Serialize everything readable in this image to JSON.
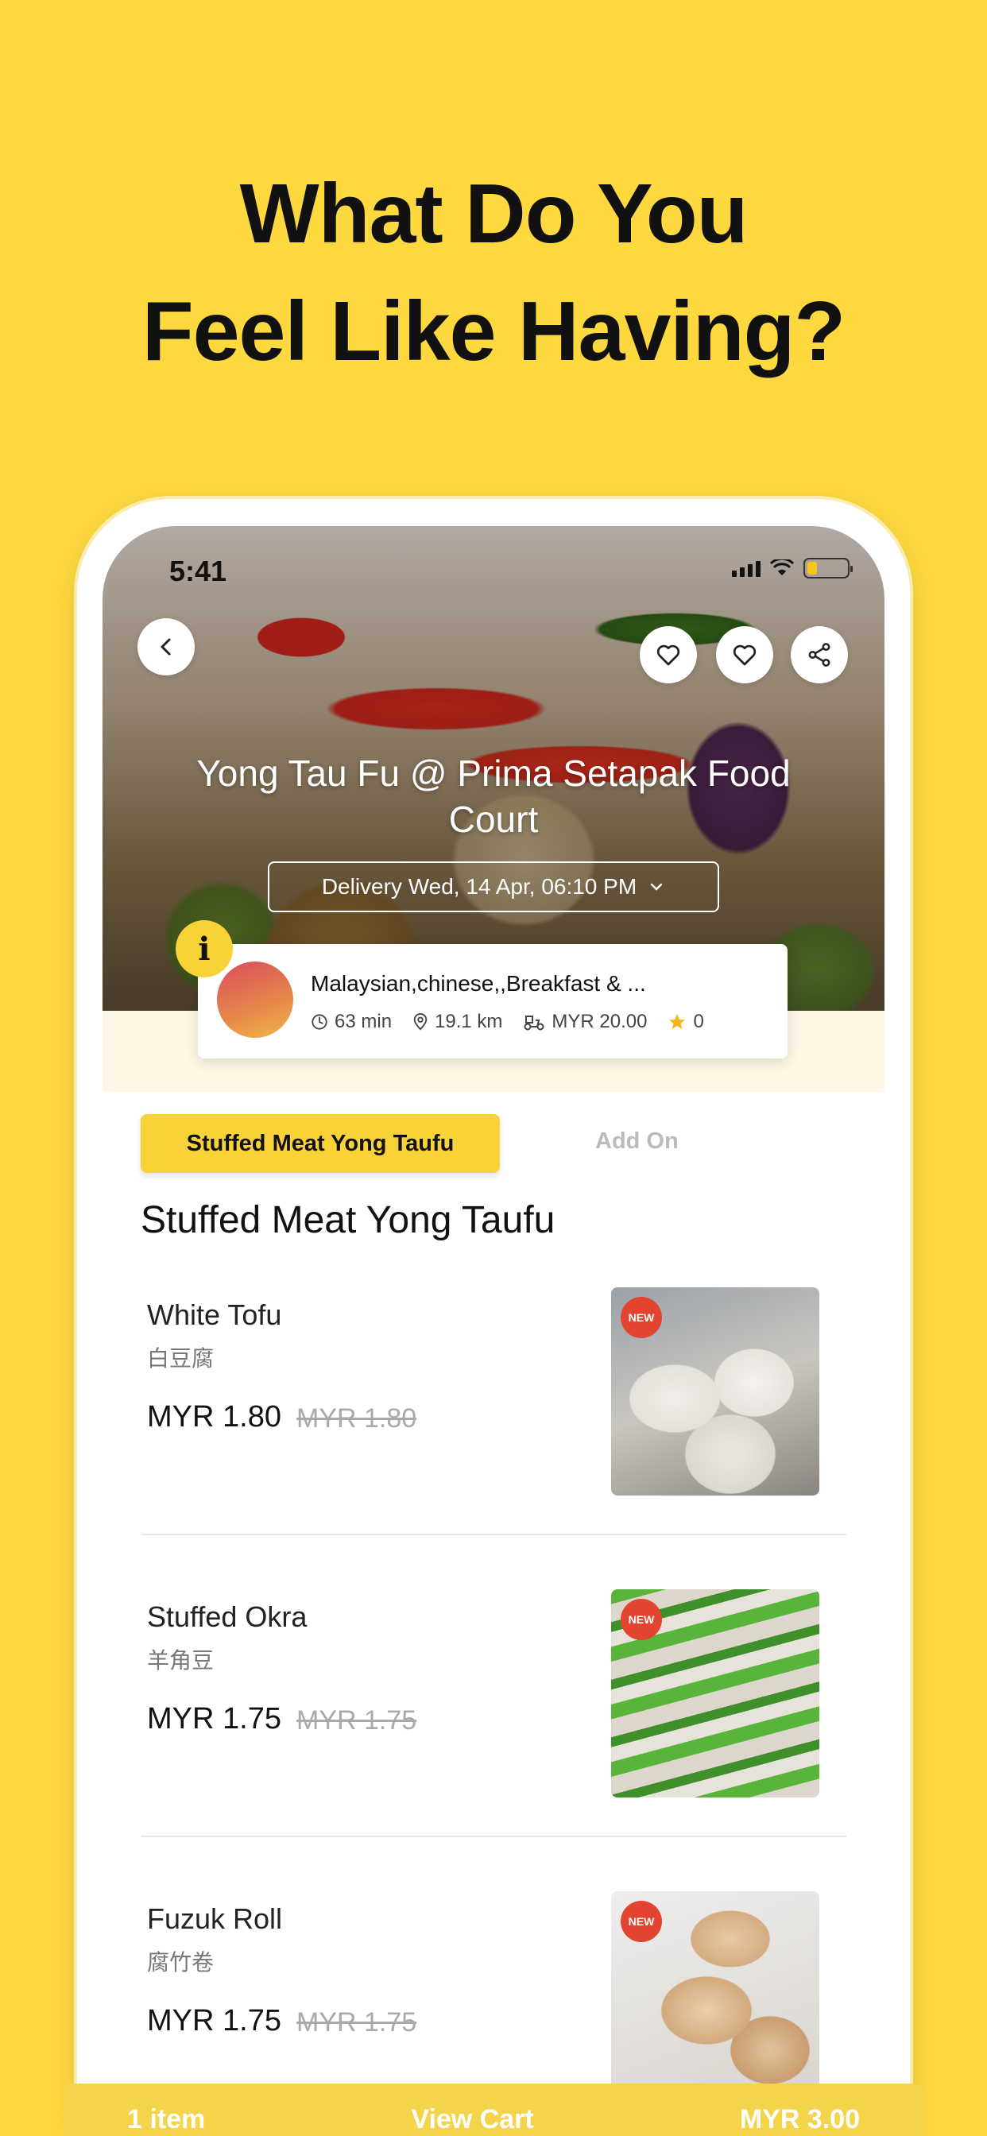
{
  "headline": {
    "line1": "What Do You",
    "line2": "Feel Like Having?"
  },
  "status_bar": {
    "time": "5:41",
    "signal_icon": "cellular-signal-icon",
    "wifi_icon": "wifi-icon",
    "battery_icon": "battery-icon"
  },
  "restaurant": {
    "name": "Yong Tau Fu @ Prima Setapak Food Court",
    "delivery": "Delivery Wed, 14 Apr, 06:10 PM",
    "cuisine": "Malaysian,chinese,,Breakfast & ...",
    "time": "63 min",
    "distance": "19.1 km",
    "delivery_fee": "MYR 20.00",
    "rating": "0",
    "info_badge": "i"
  },
  "tabs": [
    {
      "label": "Stuffed Meat Yong Taufu",
      "active": true
    },
    {
      "label": "Add On",
      "active": false
    }
  ],
  "section_title": "Stuffed Meat Yong Taufu",
  "items": [
    {
      "name": "White Tofu",
      "chinese": "白豆腐",
      "price": "MYR 1.80",
      "old_price": "MYR 1.80",
      "badge": "NEW"
    },
    {
      "name": "Stuffed Okra",
      "chinese": "羊角豆",
      "price": "MYR 1.75",
      "old_price": "MYR 1.75",
      "badge": "NEW"
    },
    {
      "name": "Fuzuk Roll",
      "chinese": "腐竹卷",
      "price": "MYR 1.75",
      "old_price": "MYR 1.75",
      "badge": "NEW"
    }
  ],
  "cart": {
    "count": "1 item",
    "label": "View Cart",
    "total": "MYR 3.00"
  },
  "colors": {
    "background": "#FDD83F",
    "accent": "#F7D338",
    "new_badge": "#e2442f"
  }
}
